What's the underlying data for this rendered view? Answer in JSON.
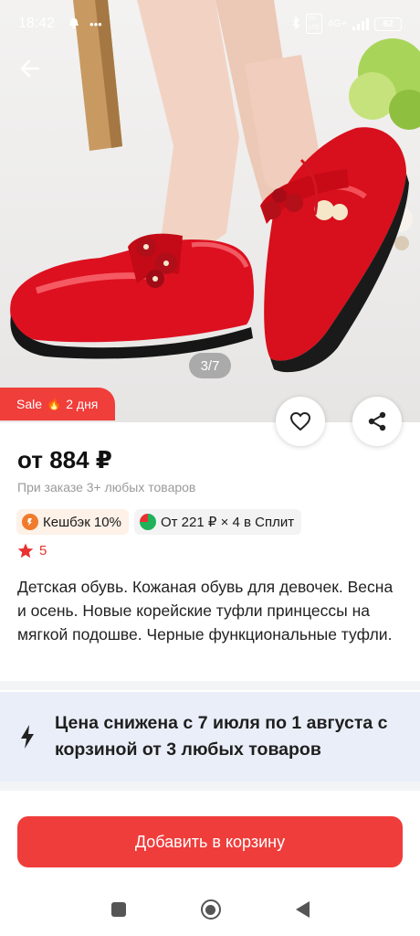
{
  "status_bar": {
    "time": "18:42",
    "battery": "62",
    "network": "4G+",
    "icons": [
      "alarm-icon",
      "more-icon",
      "bluetooth-icon",
      "volte-icon",
      "signal-icon",
      "battery-icon"
    ]
  },
  "gallery": {
    "counter": "3/7",
    "image_subject": "red patent leather girls shoes with flowers"
  },
  "sale_badge": {
    "label": "Sale",
    "icon": "fire-icon",
    "duration": "2 дня"
  },
  "actions": {
    "favorite_icon": "heart-icon",
    "share_icon": "share-icon",
    "back_icon": "arrow-left-icon"
  },
  "product": {
    "price": "от 884 ₽",
    "price_note": "При заказе 3+ любых товаров",
    "chips": [
      {
        "icon": "cashback-icon",
        "label": "Кешбэк 10%"
      },
      {
        "icon": "split-icon",
        "label": "От 221 ₽ × 4 в Сплит"
      }
    ],
    "rating": "5",
    "description": "Детская обувь. Кожаная обувь для девочек. Весна и осень. Новые корейские туфли принцессы на мягкой подошве. Черные функциональные туфли."
  },
  "promo": {
    "icon": "lightning-icon",
    "text": "Цена снижена с 7 июля по 1 августа с корзиной от 3 любых товаров"
  },
  "cart_button": {
    "label": "Добавить в корзину"
  },
  "colors": {
    "accent": "#ef3d3b",
    "promo_bg": "#e9eef8",
    "rating": "#e8322f"
  }
}
